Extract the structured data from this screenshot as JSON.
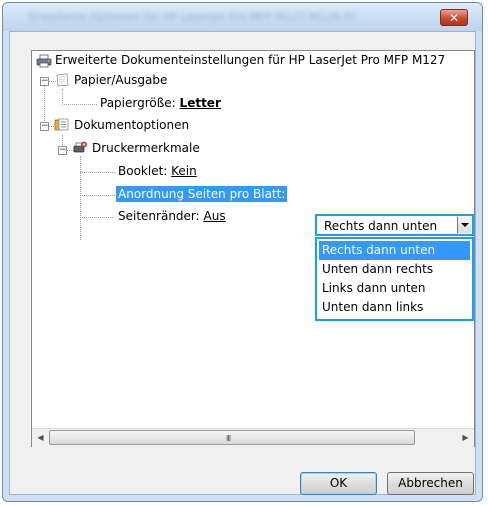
{
  "window": {
    "title": "Erweiterte Optionen für HP LaserJet Pro MFP M127-M128 PCLmS",
    "close_glyph": "✕"
  },
  "tree": {
    "root_label": "Erweiterte Dokumenteinstellungen für HP LaserJet Pro MFP M127",
    "paper_output": "Papier/Ausgabe",
    "paper_size_label": "Papiergröße: ",
    "paper_size_value": "Letter",
    "document_options": "Dokumentoptionen",
    "printer_features": "Druckermerkmale",
    "booklet_label": "Booklet: ",
    "booklet_value": "Kein",
    "pages_per_sheet_label": "Anordnung Seiten pro Blatt:",
    "margins_label": "Seitenränder: ",
    "margins_value": "Aus",
    "expander_glyph": "−"
  },
  "combo": {
    "selected_value": "Rechts dann unten",
    "options": [
      "Rechts dann unten",
      "Unten dann rechts",
      "Links dann unten",
      "Unten dann links"
    ],
    "selected_index": 0
  },
  "scrollbar": {
    "left_glyph": "◀",
    "right_glyph": "▶",
    "grip_glyph": "III"
  },
  "buttons": {
    "ok_label": "OK",
    "cancel_label": "Abbrechen"
  },
  "icons": {
    "printer": "printer-icon",
    "paper": "paper-icon",
    "documents": "documents-icon",
    "printer_features": "printer-features-icon"
  },
  "colors": {
    "selection": "#3399ff",
    "focus_border": "#1ba1e2",
    "close_button": "#c94a32"
  }
}
